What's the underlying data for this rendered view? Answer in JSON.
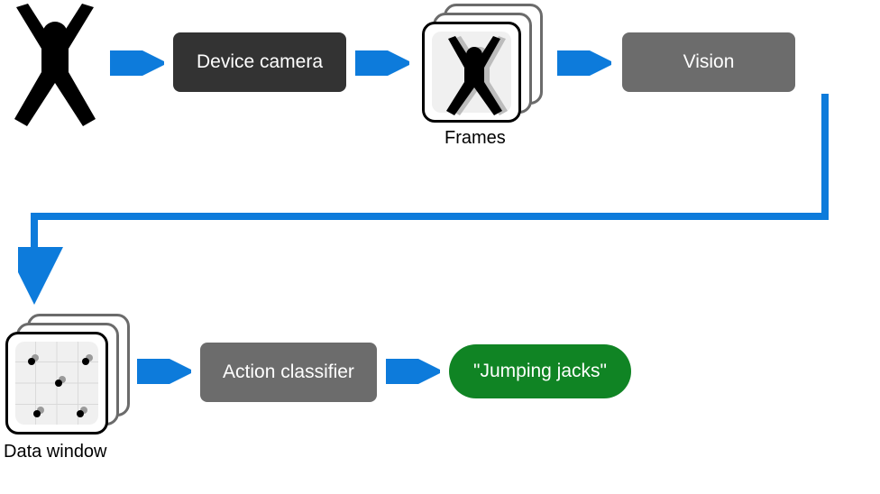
{
  "nodes": {
    "device_camera": {
      "label": "Device camera"
    },
    "frames": {
      "caption": "Frames"
    },
    "vision": {
      "label": "Vision"
    },
    "data_window": {
      "caption": "Data window"
    },
    "action_classifier": {
      "label": "Action classifier"
    },
    "result": {
      "label": "\"Jumping jacks\""
    }
  },
  "colors": {
    "arrow": "#0d7bdb",
    "box_dark": "#333333",
    "box_gray": "#6c6c6c",
    "pill_green": "#108424"
  },
  "flow": [
    "person",
    "device_camera",
    "frames",
    "vision",
    "data_window",
    "action_classifier",
    "result"
  ]
}
